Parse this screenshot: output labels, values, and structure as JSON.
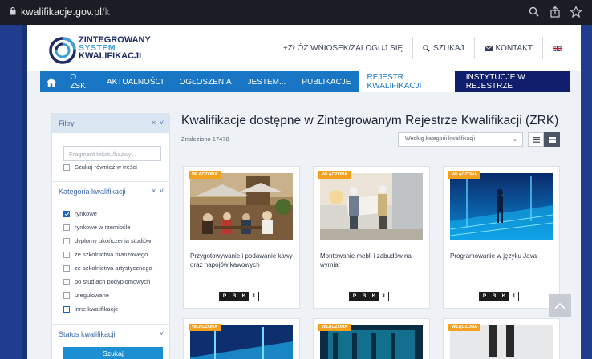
{
  "browser": {
    "url_host": "kwalifikacje.gov.pl",
    "url_path": "/k"
  },
  "header": {
    "logo_line1": "ZINTEGROWANY",
    "logo_line2": "SYSTEM",
    "logo_line3": "KWALIFIKACJI",
    "apply_login": "+ZŁÓŻ WNIOSEK/ZALOGUJ SIĘ",
    "search": "SZUKAJ",
    "contact": "KONTAKT"
  },
  "nav": [
    {
      "label": "O ZSK"
    },
    {
      "label": "AKTUALNOŚCI"
    },
    {
      "label": "OGŁOSZENIA"
    },
    {
      "label": "JESTEM..."
    },
    {
      "label": "PUBLIKACJE"
    },
    {
      "label": "REJESTR KWALIFIKACJI"
    },
    {
      "label": "INSTYTUCJE W REJESTRZE"
    }
  ],
  "sidebar": {
    "filters_label": "Filtry",
    "text_placeholder": "Fragment tekstu/hazwy...",
    "search_in_content": "Szukaj również w treści",
    "category_label": "Kategoria kwalifikacji",
    "categories": [
      {
        "label": "rynkowe",
        "checked": true
      },
      {
        "label": "rynkowe w rzemiośle",
        "checked": false
      },
      {
        "label": "dyplomy ukończenia studiów",
        "checked": false
      },
      {
        "label": "ze szkolnictwa branżowego",
        "checked": false
      },
      {
        "label": "ze szkolnictwa artystycznego",
        "checked": false
      },
      {
        "label": "po studiach podyplomowych",
        "checked": false
      },
      {
        "label": "uregulowane",
        "checked": false
      },
      {
        "label": "inne kwalifikacje",
        "checked": false
      }
    ],
    "status_label": "Status kwalifikacji",
    "search_button": "Szukaj"
  },
  "main": {
    "title": "Kwalifikacje dostępne w Zintegrowanym Rejestrze Kwalifikacji (ZRK)",
    "found": "Znaleziono 17478",
    "sort_value": "Według kategorii kwalifikacji"
  },
  "cards": [
    {
      "badge": "WŁĄCZONA",
      "title": "Przygotowywanie i podawanie kawy oraz napojów kawowych",
      "prk": [
        "P",
        "R",
        "K",
        "4"
      ]
    },
    {
      "badge": "WŁĄCZONA",
      "title": "Montowanie mebli i zabudów na wymiar",
      "prk": [
        "P",
        "R",
        "K",
        "3"
      ]
    },
    {
      "badge": "WŁĄCZONA",
      "title": "Programowanie w języku Java",
      "prk": [
        "P",
        "R",
        "K",
        "4"
      ]
    }
  ],
  "cards_row2": [
    {
      "badge": "WŁĄCZONA"
    },
    {
      "badge": "WŁĄCZONA"
    },
    {
      "badge": "WŁĄCZONA"
    }
  ],
  "colors": {
    "nav_blue": "#1976c5",
    "nav_dark": "#0f1f6b",
    "badge_orange": "#f3a11f",
    "frame_blue": "#1f3c8f"
  }
}
